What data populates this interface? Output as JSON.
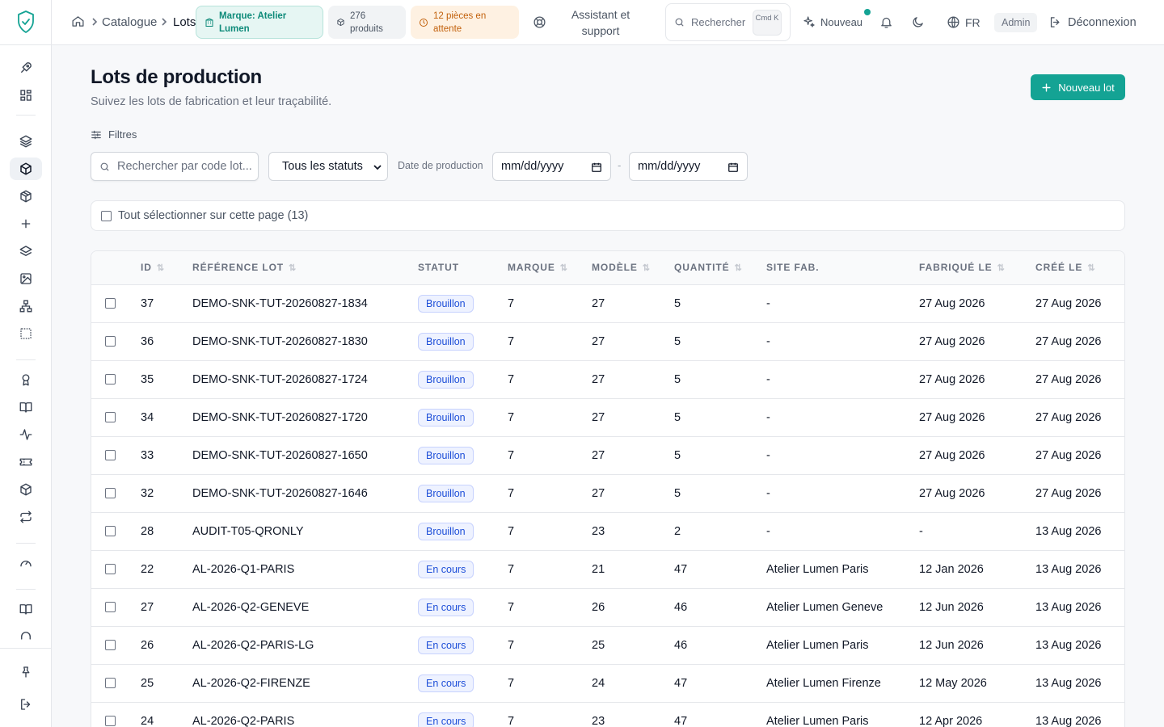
{
  "topbar": {
    "breadcrumb": [
      "Catalogue",
      "Lots"
    ],
    "brand_chip": "Marque: Atelier Lumen",
    "products_chip": "276 produits",
    "pending_chip": "12 pièces en attente",
    "assistant": "Assistant et support",
    "search_label": "Rechercher",
    "search_kbd": "Cmd K",
    "new_label": "Nouveau",
    "lang": "FR",
    "role": "Admin",
    "logout": "Déconnexion"
  },
  "page": {
    "title": "Lots de production",
    "subtitle": "Suivez les lots de fabrication et leur traçabilité.",
    "new_button": "Nouveau lot"
  },
  "filters": {
    "label": "Filtres",
    "search_placeholder": "Rechercher par code lot...",
    "status_value": "Tous les statuts",
    "date_label": "Date de production",
    "date_from": "mm/dd/yyyy",
    "date_to": "mm/dd/yyyy",
    "dash": "-"
  },
  "select_all": "Tout sélectionner sur cette page (13)",
  "table": {
    "columns": [
      "ID",
      "RÉFÉRENCE LOT",
      "STATUT",
      "MARQUE",
      "MODÈLE",
      "QUANTITÉ",
      "SITE FAB.",
      "FABRIQUÉ LE",
      "CRÉÉ LE"
    ],
    "rows": [
      {
        "id": "37",
        "ref": "DEMO-SNK-TUT-20260827-1834",
        "status": "Brouillon",
        "brand": "7",
        "model": "27",
        "qty": "5",
        "site": "-",
        "made": "27 Aug 2026",
        "created": "27 Aug 2026"
      },
      {
        "id": "36",
        "ref": "DEMO-SNK-TUT-20260827-1830",
        "status": "Brouillon",
        "brand": "7",
        "model": "27",
        "qty": "5",
        "site": "-",
        "made": "27 Aug 2026",
        "created": "27 Aug 2026"
      },
      {
        "id": "35",
        "ref": "DEMO-SNK-TUT-20260827-1724",
        "status": "Brouillon",
        "brand": "7",
        "model": "27",
        "qty": "5",
        "site": "-",
        "made": "27 Aug 2026",
        "created": "27 Aug 2026"
      },
      {
        "id": "34",
        "ref": "DEMO-SNK-TUT-20260827-1720",
        "status": "Brouillon",
        "brand": "7",
        "model": "27",
        "qty": "5",
        "site": "-",
        "made": "27 Aug 2026",
        "created": "27 Aug 2026"
      },
      {
        "id": "33",
        "ref": "DEMO-SNK-TUT-20260827-1650",
        "status": "Brouillon",
        "brand": "7",
        "model": "27",
        "qty": "5",
        "site": "-",
        "made": "27 Aug 2026",
        "created": "27 Aug 2026"
      },
      {
        "id": "32",
        "ref": "DEMO-SNK-TUT-20260827-1646",
        "status": "Brouillon",
        "brand": "7",
        "model": "27",
        "qty": "5",
        "site": "-",
        "made": "27 Aug 2026",
        "created": "27 Aug 2026"
      },
      {
        "id": "28",
        "ref": "AUDIT-T05-QRONLY",
        "status": "Brouillon",
        "brand": "7",
        "model": "23",
        "qty": "2",
        "site": "-",
        "made": "-",
        "created": "13 Aug 2026"
      },
      {
        "id": "22",
        "ref": "AL-2026-Q1-PARIS",
        "status": "En cours",
        "brand": "7",
        "model": "21",
        "qty": "47",
        "site": "Atelier Lumen Paris",
        "made": "12 Jan 2026",
        "created": "13 Aug 2026"
      },
      {
        "id": "27",
        "ref": "AL-2026-Q2-GENEVE",
        "status": "En cours",
        "brand": "7",
        "model": "26",
        "qty": "46",
        "site": "Atelier Lumen Geneve",
        "made": "12 Jun 2026",
        "created": "13 Aug 2026"
      },
      {
        "id": "26",
        "ref": "AL-2026-Q2-PARIS-LG",
        "status": "En cours",
        "brand": "7",
        "model": "25",
        "qty": "46",
        "site": "Atelier Lumen Paris",
        "made": "12 Jun 2026",
        "created": "13 Aug 2026"
      },
      {
        "id": "25",
        "ref": "AL-2026-Q2-FIRENZE",
        "status": "En cours",
        "brand": "7",
        "model": "24",
        "qty": "47",
        "site": "Atelier Lumen Firenze",
        "made": "12 May 2026",
        "created": "13 Aug 2026"
      },
      {
        "id": "24",
        "ref": "AL-2026-Q2-PARIS",
        "status": "En cours",
        "brand": "7",
        "model": "23",
        "qty": "47",
        "site": "Atelier Lumen Paris",
        "made": "12 Apr 2026",
        "created": "13 Aug 2026"
      }
    ]
  },
  "colors": {
    "accent": "#14a394",
    "badge_text": "#1d4ed8"
  }
}
